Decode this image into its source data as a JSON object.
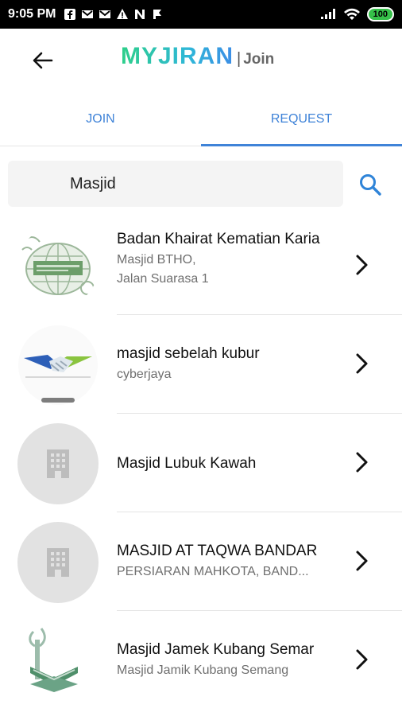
{
  "status_bar": {
    "time": "9:05 PM",
    "battery": "100"
  },
  "header": {
    "brand": "MYJIRAN",
    "separator": "|",
    "subtitle": "Join"
  },
  "tabs": [
    {
      "label": "JOIN",
      "active": false
    },
    {
      "label": "REQUEST",
      "active": true
    }
  ],
  "search": {
    "value": "Masjid"
  },
  "results": [
    {
      "title": "Badan Khairat Kematian Karia",
      "line1": "Masjid BTHO,",
      "line2": "Jalan Suarasa 1",
      "avatar": "logo-globe"
    },
    {
      "title": "masjid sebelah kubur",
      "line1": "cyberjaya",
      "line2": "",
      "avatar": "logo-handshake"
    },
    {
      "title": "Masjid Lubuk Kawah",
      "line1": "",
      "line2": "",
      "avatar": "building-placeholder-icon"
    },
    {
      "title": "MASJID AT TAQWA BANDAR",
      "line1": "PERSIARAN MAHKOTA, BAND...",
      "line2": "",
      "avatar": "building-placeholder-icon"
    },
    {
      "title": "Masjid Jamek Kubang Semar",
      "line1": "Masjid Jamik Kubang Semang",
      "line2": "",
      "avatar": "logo-book"
    }
  ],
  "colors": {
    "accent": "#3f83d8",
    "brand_green": "#2ecf8a",
    "brand_blue": "#3c8de6"
  }
}
